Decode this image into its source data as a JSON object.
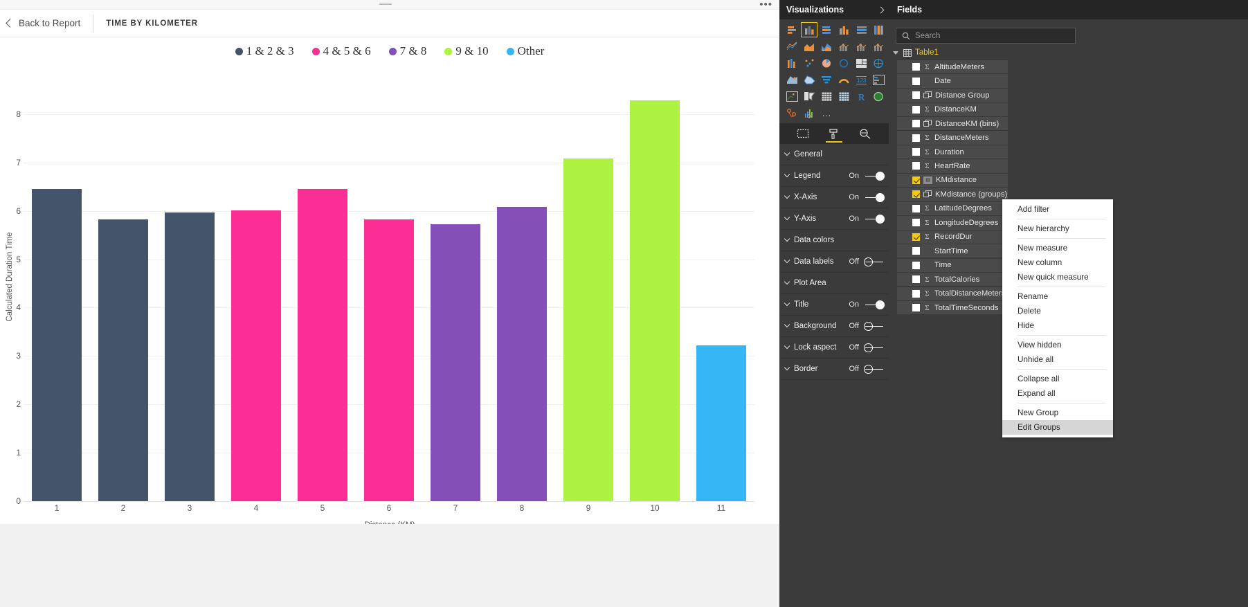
{
  "header": {
    "back_label": "Back to Report",
    "report_title": "TIME BY KILOMETER",
    "overflow": "•••"
  },
  "chart_data": {
    "type": "bar",
    "title": "TIME BY KILOMETER",
    "xlabel": "Distance (KM)",
    "ylabel": "Calculated Duration Time",
    "categories": [
      "1",
      "2",
      "3",
      "4",
      "5",
      "6",
      "7",
      "8",
      "9",
      "10",
      "11"
    ],
    "values": [
      6.45,
      5.83,
      5.97,
      6.01,
      6.45,
      5.82,
      5.73,
      6.08,
      7.08,
      8.28,
      3.22
    ],
    "bar_colors": [
      "#44546a",
      "#44546a",
      "#44546a",
      "#fa2e95",
      "#fa2e95",
      "#fa2e95",
      "#8450b8",
      "#8450b8",
      "#adf240",
      "#adf240",
      "#36b6f5"
    ],
    "ylim": [
      0,
      8.6
    ],
    "yticks": [
      "0",
      "1",
      "2",
      "3",
      "4",
      "5",
      "6",
      "7",
      "8"
    ],
    "grid": true,
    "legend_position": "top",
    "legend": [
      {
        "label": "1 & 2 & 3",
        "color": "#44546a"
      },
      {
        "label": "4 & 5 & 6",
        "color": "#fa2e95"
      },
      {
        "label": "7 & 8",
        "color": "#8450b8"
      },
      {
        "label": "9 & 10",
        "color": "#adf240"
      },
      {
        "label": "Other",
        "color": "#36b6f5"
      }
    ]
  },
  "visualizations": {
    "title": "Visualizations",
    "collapse_icon": "chevron-right-icon",
    "icons": [
      "stacked-bar-chart-icon",
      "clustered-column-chart-icon",
      "clustered-bar-chart-icon",
      "column-chart-icon",
      "hundred-percent-stacked-bar-icon",
      "hundred-percent-stacked-column-icon",
      "line-chart-icon",
      "area-chart-icon",
      "stacked-area-chart-icon",
      "line-and-stacked-column-icon",
      "line-and-clustered-column-icon",
      "ribbon-chart-icon",
      "waterfall-chart-icon",
      "scatter-chart-icon",
      "pie-chart-icon",
      "donut-chart-icon",
      "treemap-icon",
      "map-icon",
      "filled-map-icon",
      "shape-map-icon",
      "funnel-icon",
      "gauge-icon",
      "card-icon",
      "multi-row-card-icon",
      "kpi-icon",
      "slicer-icon",
      "table-icon",
      "matrix-icon",
      "r-script-visual-icon",
      "arcgis-map-icon",
      "esri-map-icon",
      "power-kpi-icon",
      "more-visuals-icon"
    ],
    "selected_icon_index": 1,
    "tabs": [
      {
        "name": "fields-tab",
        "icon": "fields-pane-icon",
        "active": false
      },
      {
        "name": "format-tab",
        "icon": "paint-roller-icon",
        "active": true
      },
      {
        "name": "analytics-tab",
        "icon": "magnifier-analytics-icon",
        "active": false
      }
    ],
    "format_sections": [
      {
        "label": "General",
        "state": "",
        "toggle": null
      },
      {
        "label": "Legend",
        "state": "On",
        "toggle": "on"
      },
      {
        "label": "X-Axis",
        "state": "On",
        "toggle": "on"
      },
      {
        "label": "Y-Axis",
        "state": "On",
        "toggle": "on"
      },
      {
        "label": "Data colors",
        "state": "",
        "toggle": null
      },
      {
        "label": "Data labels",
        "state": "Off",
        "toggle": "off"
      },
      {
        "label": "Plot Area",
        "state": "",
        "toggle": null
      },
      {
        "label": "Title",
        "state": "On",
        "toggle": "on"
      },
      {
        "label": "Background",
        "state": "Off",
        "toggle": "off"
      },
      {
        "label": "Lock aspect",
        "state": "Off",
        "toggle": "off"
      },
      {
        "label": "Border",
        "state": "Off",
        "toggle": "off"
      }
    ]
  },
  "fields": {
    "title": "Fields",
    "search_placeholder": "Search",
    "table_name": "Table1",
    "items": [
      {
        "label": "AltitudeMeters",
        "checked": false,
        "icon": "sigma-icon"
      },
      {
        "label": "Date",
        "checked": false,
        "icon": "none"
      },
      {
        "label": "Distance Group",
        "checked": false,
        "icon": "group-icon"
      },
      {
        "label": "DistanceKM",
        "checked": false,
        "icon": "sigma-icon"
      },
      {
        "label": "DistanceKM (bins)",
        "checked": false,
        "icon": "group-icon"
      },
      {
        "label": "DistanceMeters",
        "checked": false,
        "icon": "sigma-icon"
      },
      {
        "label": "Duration",
        "checked": false,
        "icon": "sigma-icon"
      },
      {
        "label": "HeartRate",
        "checked": false,
        "icon": "sigma-icon"
      },
      {
        "label": "KMdistance",
        "checked": true,
        "icon": "bin-icon"
      },
      {
        "label": "KMdistance (groups)",
        "checked": true,
        "icon": "group-icon"
      },
      {
        "label": "LatitudeDegrees",
        "checked": false,
        "icon": "sigma-icon"
      },
      {
        "label": "LongitudeDegrees",
        "checked": false,
        "icon": "sigma-icon"
      },
      {
        "label": "RecordDur",
        "checked": true,
        "icon": "sigma-icon"
      },
      {
        "label": "StartTime",
        "checked": false,
        "icon": "none"
      },
      {
        "label": "Time",
        "checked": false,
        "icon": "none"
      },
      {
        "label": "TotalCalories",
        "checked": false,
        "icon": "sigma-icon"
      },
      {
        "label": "TotalDistanceMeters",
        "checked": false,
        "icon": "sigma-icon"
      },
      {
        "label": "TotalTimeSeconds",
        "checked": false,
        "icon": "sigma-icon"
      }
    ]
  },
  "context_menu": {
    "items": [
      {
        "label": "Add filter",
        "separator_after": true,
        "highlight": false
      },
      {
        "label": "New hierarchy",
        "separator_after": true,
        "highlight": false
      },
      {
        "label": "New measure",
        "separator_after": false,
        "highlight": false
      },
      {
        "label": "New column",
        "separator_after": false,
        "highlight": false
      },
      {
        "label": "New quick measure",
        "separator_after": true,
        "highlight": false
      },
      {
        "label": "Rename",
        "separator_after": false,
        "highlight": false
      },
      {
        "label": "Delete",
        "separator_after": false,
        "highlight": false
      },
      {
        "label": "Hide",
        "separator_after": true,
        "highlight": false
      },
      {
        "label": "View hidden",
        "separator_after": false,
        "highlight": false
      },
      {
        "label": "Unhide all",
        "separator_after": true,
        "highlight": false
      },
      {
        "label": "Collapse all",
        "separator_after": false,
        "highlight": false
      },
      {
        "label": "Expand all",
        "separator_after": true,
        "highlight": false
      },
      {
        "label": "New Group",
        "separator_after": false,
        "highlight": false
      },
      {
        "label": "Edit Groups",
        "separator_after": false,
        "highlight": true
      }
    ]
  }
}
